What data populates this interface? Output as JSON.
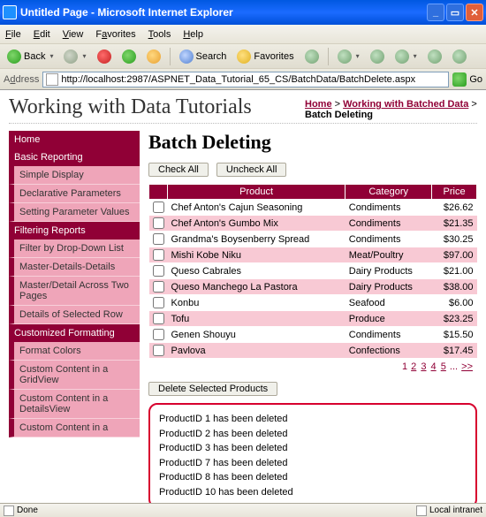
{
  "window": {
    "title": "Untitled Page - Microsoft Internet Explorer"
  },
  "menu": {
    "file": "File",
    "edit": "Edit",
    "view": "View",
    "favorites": "Favorites",
    "tools": "Tools",
    "help": "Help"
  },
  "toolbar": {
    "back": "Back",
    "search": "Search",
    "favorites": "Favorites"
  },
  "address": {
    "label": "Address",
    "url": "http://localhost:2987/ASPNET_Data_Tutorial_65_CS/BatchData/BatchDelete.aspx",
    "go": "Go"
  },
  "brand": "Working with Data Tutorials",
  "breadcrumb": {
    "home": "Home",
    "section": "Working with Batched Data",
    "current": "Batch Deleting"
  },
  "sidebar": {
    "groups": [
      {
        "head": "Home",
        "items": []
      },
      {
        "head": "Basic Reporting",
        "items": [
          "Simple Display",
          "Declarative Parameters",
          "Setting Parameter Values"
        ]
      },
      {
        "head": "Filtering Reports",
        "items": [
          "Filter by Drop-Down List",
          "Master-Details-Details",
          "Master/Detail Across Two Pages",
          "Details of Selected Row"
        ]
      },
      {
        "head": "Customized Formatting",
        "items": [
          "Format Colors",
          "Custom Content in a GridView",
          "Custom Content in a DetailsView",
          "Custom Content in a"
        ]
      }
    ]
  },
  "page": {
    "heading": "Batch Deleting",
    "check_all": "Check All",
    "uncheck_all": "Uncheck All",
    "columns": {
      "product": "Product",
      "category": "Category",
      "price": "Price"
    },
    "rows": [
      {
        "name": "Chef Anton's Cajun Seasoning",
        "cat": "Condiments",
        "price": "$26.62"
      },
      {
        "name": "Chef Anton's Gumbo Mix",
        "cat": "Condiments",
        "price": "$21.35"
      },
      {
        "name": "Grandma's Boysenberry Spread",
        "cat": "Condiments",
        "price": "$30.25"
      },
      {
        "name": "Mishi Kobe Niku",
        "cat": "Meat/Poultry",
        "price": "$97.00"
      },
      {
        "name": "Queso Cabrales",
        "cat": "Dairy Products",
        "price": "$21.00"
      },
      {
        "name": "Queso Manchego La Pastora",
        "cat": "Dairy Products",
        "price": "$38.00"
      },
      {
        "name": "Konbu",
        "cat": "Seafood",
        "price": "$6.00"
      },
      {
        "name": "Tofu",
        "cat": "Produce",
        "price": "$23.25"
      },
      {
        "name": "Genen Shouyu",
        "cat": "Condiments",
        "price": "$15.50"
      },
      {
        "name": "Pavlova",
        "cat": "Confections",
        "price": "$17.45"
      }
    ],
    "pager": {
      "current": "1",
      "links": [
        "2",
        "3",
        "4",
        "5"
      ],
      "more": "...",
      "next": ">>"
    },
    "delete_btn": "Delete Selected Products",
    "messages": [
      "ProductID 1 has been deleted",
      "ProductID 2 has been deleted",
      "ProductID 3 has been deleted",
      "ProductID 7 has been deleted",
      "ProductID 8 has been deleted",
      "ProductID 10 has been deleted"
    ]
  },
  "status": {
    "done": "Done",
    "zone": "Local intranet"
  }
}
